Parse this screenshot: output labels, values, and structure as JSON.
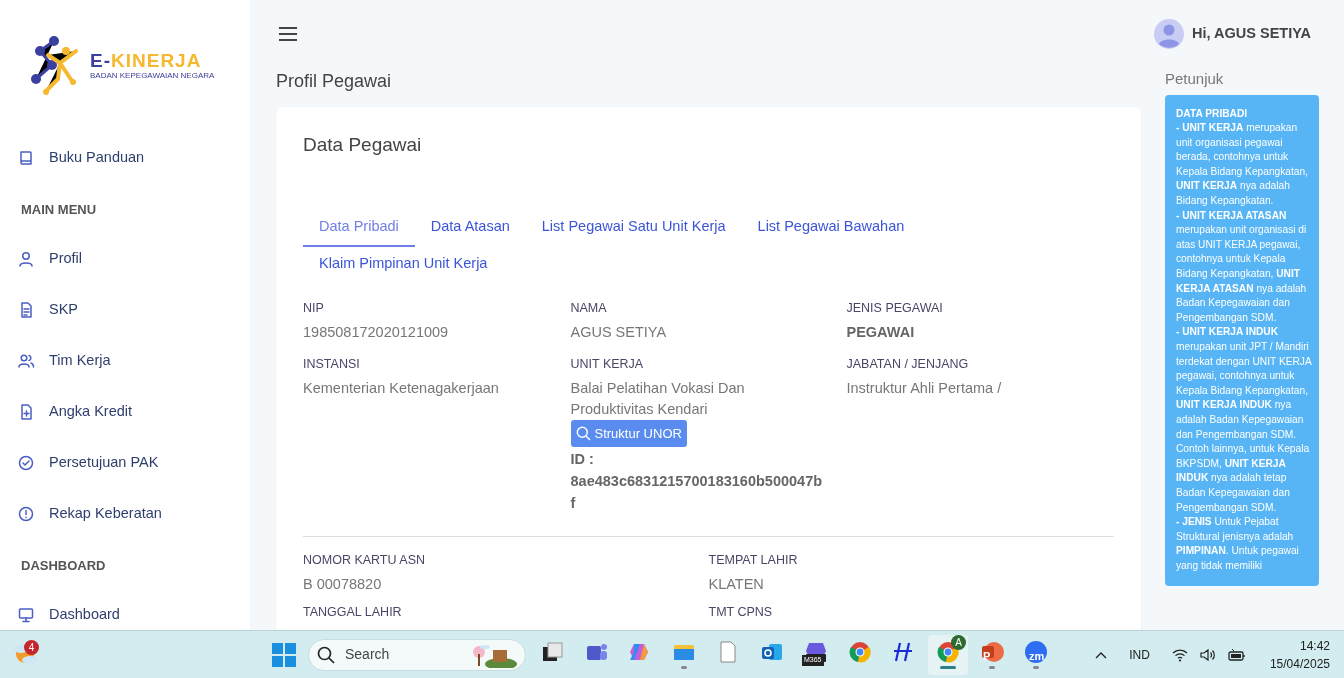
{
  "logo": {
    "title_lead": "E-",
    "title_rest": "KINERJA",
    "subtitle": "BADAN KEPEGAWAIAN NEGARA"
  },
  "sidebar": {
    "items": [
      {
        "kind": "link",
        "label": "Buku Panduan"
      },
      {
        "kind": "heading",
        "label": "MAIN MENU"
      },
      {
        "kind": "link",
        "label": "Profil"
      },
      {
        "kind": "link",
        "label": "SKP"
      },
      {
        "kind": "link",
        "label": "Tim Kerja"
      },
      {
        "kind": "link",
        "label": "Angka Kredit"
      },
      {
        "kind": "link",
        "label": "Persetujuan PAK"
      },
      {
        "kind": "link",
        "label": "Rekap Keberatan"
      },
      {
        "kind": "heading",
        "label": "DASHBOARD"
      },
      {
        "kind": "link",
        "label": "Dashboard"
      }
    ]
  },
  "header": {
    "user": "Hi, AGUS SETIYA"
  },
  "page_title": "Profil Pegawai",
  "card": {
    "title": "Data Pegawai",
    "tabs": [
      {
        "label": "Data Pribadi",
        "selected": true
      },
      {
        "label": "Data Atasan",
        "selected": false
      },
      {
        "label": "List Pegawai Satu Unit Kerja",
        "selected": false
      },
      {
        "label": "List Pegawai Bawahan",
        "selected": false
      },
      {
        "label": "Klaim Pimpinan Unit Kerja",
        "selected": false
      }
    ],
    "fields": [
      {
        "label": "NIP",
        "value": "198508172020121009",
        "emphasis": false
      },
      {
        "label": "NAMA",
        "value": "AGUS SETIYA",
        "emphasis": false
      },
      {
        "label": "JENIS PEGAWAI",
        "value": "PEGAWAI",
        "emphasis": true
      },
      {
        "label": "INSTANSI",
        "value": "Kementerian Ketenagakerjaan",
        "emphasis": false
      },
      {
        "label": "UNIT KERJA",
        "value": "Balai Pelatihan Vokasi Dan Produktivitas Kendari",
        "emphasis": false,
        "button": "Struktur UNOR",
        "id_label": "ID :",
        "id_value": "8ae483c6831215700183160b500047bf"
      },
      {
        "label": "JABATAN / JENJANG",
        "value": "Instruktur Ahli Pertama /",
        "emphasis": false
      }
    ],
    "fields_2": [
      {
        "label": "NOMOR KARTU ASN",
        "value": "B 00078820"
      },
      {
        "label": "TEMPAT LAHIR",
        "value": "KLATEN"
      },
      {
        "label": "TANGGAL LAHIR"
      },
      {
        "label": "TMT CPNS"
      }
    ]
  },
  "help": {
    "title": "Petunjuk",
    "paragraphs": [
      "**DATA PRIBADI**",
      "**- UNIT KERJA** merupakan unit organisasi pegawai berada, contohnya untuk Kepala Bidang Kepangkatan, **UNIT KERJA** nya adalah Bidang Kepangkatan.",
      "**- UNIT KERJA ATASAN** merupakan unit organisasi di atas UNIT KERJA pegawai, contohnya untuk Kepala Bidang Kepangkatan, **UNIT KERJA ATASAN** nya adalah Badan Kepegawaian dan Pengembangan SDM.",
      "**- UNIT KERJA INDUK** merupakan unit JPT / Mandiri terdekat dengan UNIT KERJA pegawai, contohnya untuk Kepala Bidang Kepangkatan, **UNIT KERJA INDUK** nya adalah Badan Kepegawaian dan Pengembangan SDM. Contoh lainnya, untuk Kepala BKPSDM, **UNIT KERJA INDUK** nya adalah tetap Badan Kepegawaian dan Pengembangan SDM.",
      "**- JENIS** Untuk Pejabat Struktural jenisnya adalah **PIMPINAN**. Untuk pegawai yang tidak memiliki"
    ]
  },
  "taskbar": {
    "weather_badge": "4",
    "search_placeholder": "Search",
    "apps": [
      {
        "running": false,
        "selected": false
      },
      {
        "running": false,
        "selected": false
      },
      {
        "running": false,
        "selected": false
      },
      {
        "running": true,
        "selected": false
      },
      {
        "running": false,
        "selected": false
      },
      {
        "running": false,
        "selected": false
      },
      {
        "running": false,
        "selected": false,
        "badge": "M365"
      },
      {
        "running": false,
        "selected": false
      },
      {
        "running": false,
        "selected": false
      },
      {
        "running": true,
        "selected": true,
        "badge": "A"
      },
      {
        "running": true,
        "selected": false,
        "badge": "P"
      },
      {
        "running": true,
        "selected": false,
        "badge": "zm"
      }
    ],
    "language": "IND",
    "time": "14:42",
    "date": "15/04/2025"
  }
}
